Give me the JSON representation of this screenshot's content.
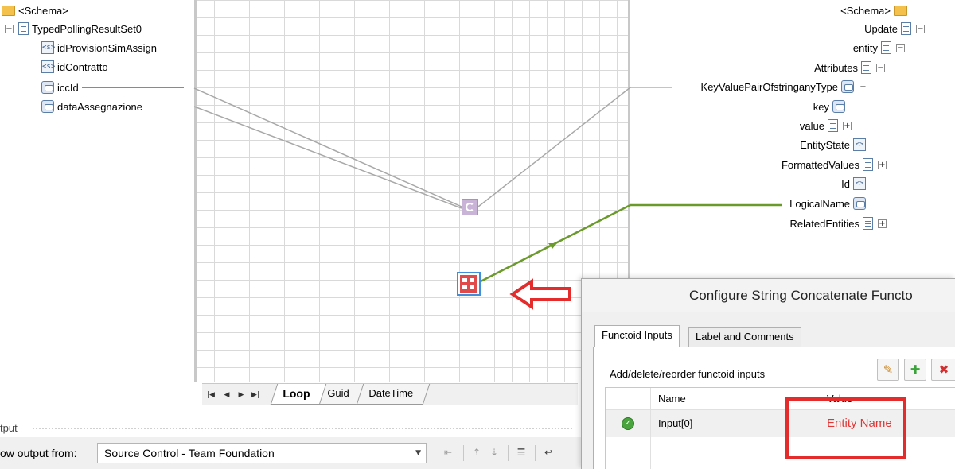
{
  "left_schema": {
    "root": "<Schema>",
    "record": "TypedPollingResultSet0",
    "fields": [
      "idProvisionSimAssign",
      "idContratto",
      "iccId",
      "dataAssegnazione"
    ]
  },
  "right_schema": {
    "root": "<Schema>",
    "nodes": [
      "Update",
      "entity",
      "Attributes",
      "KeyValuePairOfstringanyType",
      "key",
      "value",
      "EntityState",
      "FormattedValues",
      "Id",
      "LogicalName",
      "RelatedEntities"
    ]
  },
  "map_tabs": [
    "Loop",
    "Guid",
    "DateTime"
  ],
  "active_map_tab": "Loop",
  "output": {
    "title": "tput",
    "show_from_label": "ow output from:",
    "source": "Source Control - Team Foundation"
  },
  "dialog": {
    "title": "Configure String Concatenate Functo",
    "tabs": [
      "Functoid Inputs",
      "Label and Comments"
    ],
    "active_tab": "Functoid Inputs",
    "caption": "Add/delete/reorder functoid inputs",
    "columns": [
      "Name",
      "Value"
    ],
    "rows": [
      {
        "name": "Input[0]",
        "value": "Entity Name"
      }
    ]
  },
  "colors": {
    "link_gray": "#a0a0a0",
    "link_green": "#6a9a2a",
    "annotation_red": "#e52c2c",
    "selection_blue": "#3f8fdb"
  }
}
